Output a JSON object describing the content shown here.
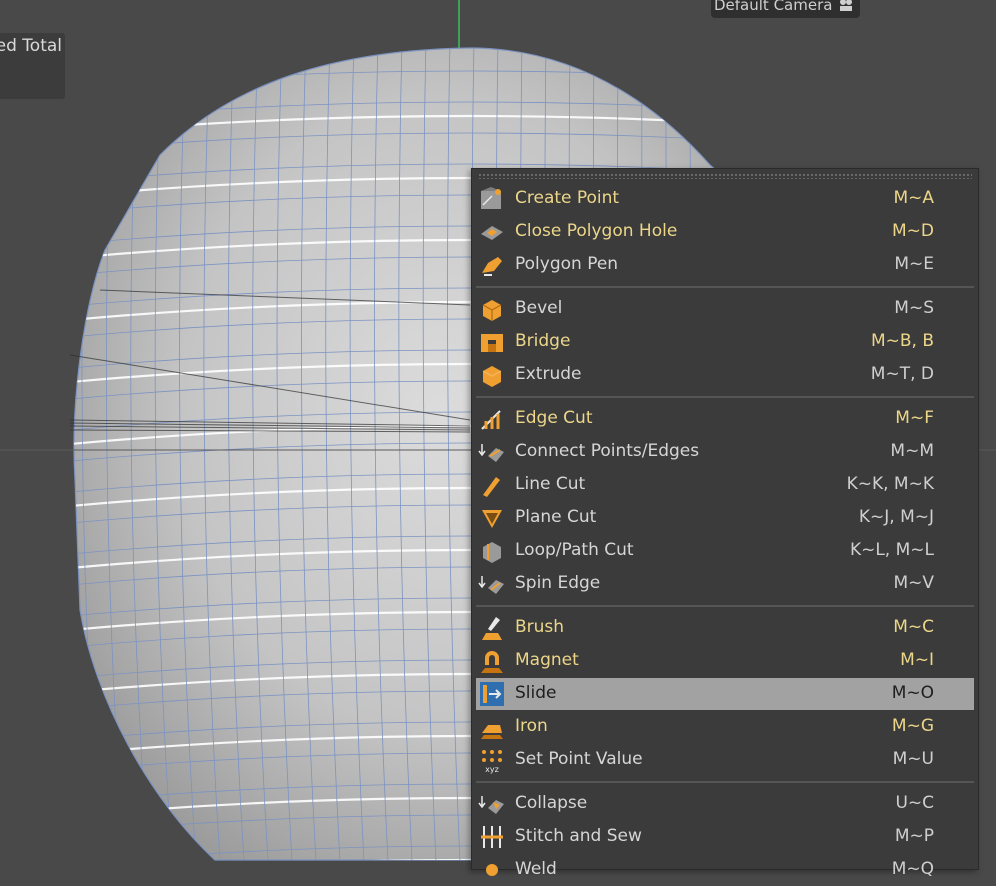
{
  "viewport": {
    "hud_text": "ed Total",
    "camera_label": "Default Camera"
  },
  "menu": {
    "groups": [
      [
        {
          "label": "Create Point",
          "shortcut": "M~A",
          "highlighted_text": true,
          "icon": "create-point-icon"
        },
        {
          "label": "Close Polygon Hole",
          "shortcut": "M~D",
          "highlighted_text": true,
          "icon": "close-polygon-hole-icon"
        },
        {
          "label": "Polygon Pen",
          "shortcut": "M~E",
          "highlighted_text": false,
          "icon": "polygon-pen-icon"
        }
      ],
      [
        {
          "label": "Bevel",
          "shortcut": "M~S",
          "highlighted_text": false,
          "icon": "bevel-icon"
        },
        {
          "label": "Bridge",
          "shortcut": "M~B, B",
          "highlighted_text": true,
          "icon": "bridge-icon"
        },
        {
          "label": "Extrude",
          "shortcut": "M~T, D",
          "highlighted_text": false,
          "icon": "extrude-icon"
        }
      ],
      [
        {
          "label": "Edge Cut",
          "shortcut": "M~F",
          "highlighted_text": true,
          "icon": "edge-cut-icon"
        },
        {
          "label": "Connect Points/Edges",
          "shortcut": "M~M",
          "highlighted_text": false,
          "icon": "connect-points-edges-icon"
        },
        {
          "label": "Line Cut",
          "shortcut": "K~K, M~K",
          "highlighted_text": false,
          "icon": "line-cut-icon"
        },
        {
          "label": "Plane Cut",
          "shortcut": "K~J, M~J",
          "highlighted_text": false,
          "icon": "plane-cut-icon"
        },
        {
          "label": "Loop/Path Cut",
          "shortcut": "K~L, M~L",
          "highlighted_text": false,
          "icon": "loop-path-cut-icon"
        },
        {
          "label": "Spin Edge",
          "shortcut": "M~V",
          "highlighted_text": false,
          "icon": "spin-edge-icon"
        }
      ],
      [
        {
          "label": "Brush",
          "shortcut": "M~C",
          "highlighted_text": true,
          "icon": "brush-icon"
        },
        {
          "label": "Magnet",
          "shortcut": "M~I",
          "highlighted_text": true,
          "icon": "magnet-icon"
        },
        {
          "label": "Slide",
          "shortcut": "M~O",
          "highlighted_text": false,
          "hover": true,
          "icon": "slide-icon"
        },
        {
          "label": "Iron",
          "shortcut": "M~G",
          "highlighted_text": true,
          "icon": "iron-icon"
        },
        {
          "label": "Set Point Value",
          "shortcut": "M~U",
          "highlighted_text": false,
          "icon": "set-point-value-icon"
        }
      ],
      [
        {
          "label": "Collapse",
          "shortcut": "U~C",
          "highlighted_text": false,
          "icon": "collapse-icon"
        },
        {
          "label": "Stitch and Sew",
          "shortcut": "M~P",
          "highlighted_text": false,
          "icon": "stitch-and-sew-icon"
        },
        {
          "label": "Weld",
          "shortcut": "M~Q",
          "highlighted_text": false,
          "icon": "weld-icon"
        }
      ]
    ]
  },
  "colors": {
    "viewport_bg": "#494949",
    "menu_bg": "#3b3b3b",
    "highlight_text": "#ecd68a",
    "hover_bg": "#a2a2a2",
    "accent_orange": "#f0a030"
  }
}
